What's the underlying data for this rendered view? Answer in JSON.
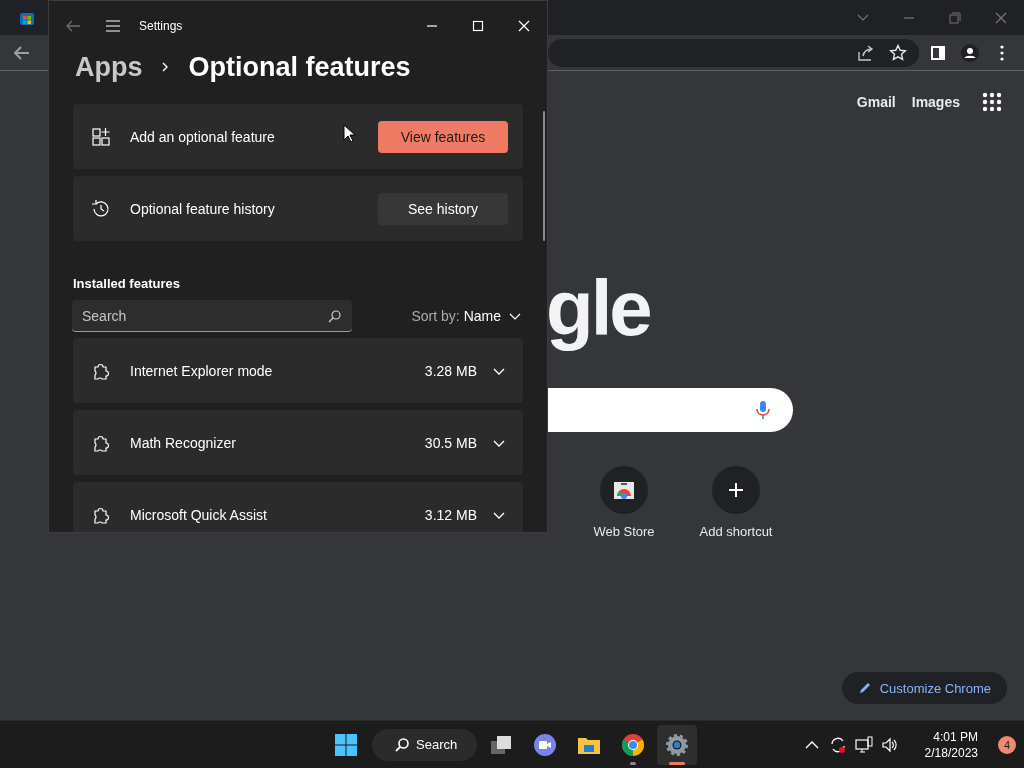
{
  "browser": {
    "header_links": [
      "Gmail",
      "Images"
    ],
    "logo_text": "gle",
    "shortcuts": [
      {
        "label": "Web Store",
        "kind": "store"
      },
      {
        "label": "Add shortcut",
        "kind": "add"
      }
    ],
    "customize_button": "Customize Chrome"
  },
  "settings_window": {
    "title": "Settings",
    "back_disabled": true,
    "breadcrumb": [
      "Apps",
      "Optional features"
    ],
    "actions": [
      {
        "label": "Add an optional feature",
        "button": "View features",
        "kind": "add",
        "primary": true
      },
      {
        "label": "Optional feature history",
        "button": "See history",
        "kind": "history",
        "primary": false
      }
    ],
    "installed": {
      "heading": "Installed features",
      "search": {
        "placeholder": "Search"
      },
      "sort": {
        "label": "Sort by:",
        "value": "Name"
      },
      "features": [
        {
          "name": "Internet Explorer mode",
          "size": "3.28 MB"
        },
        {
          "name": "Math Recognizer",
          "size": "30.5 MB"
        },
        {
          "name": "Microsoft Quick Assist",
          "size": "3.12 MB"
        }
      ]
    }
  },
  "taskbar": {
    "search_label": "Search",
    "apps": [
      {
        "kind": "taskview",
        "running": false,
        "active": false
      },
      {
        "kind": "meet",
        "running": false,
        "active": false
      },
      {
        "kind": "explorer",
        "running": false,
        "active": false
      },
      {
        "kind": "chrome",
        "running": true,
        "active": false
      },
      {
        "kind": "settings",
        "running": true,
        "active": true
      }
    ],
    "time": "4:01 PM",
    "date": "2/18/2023",
    "notification_count": "4"
  }
}
